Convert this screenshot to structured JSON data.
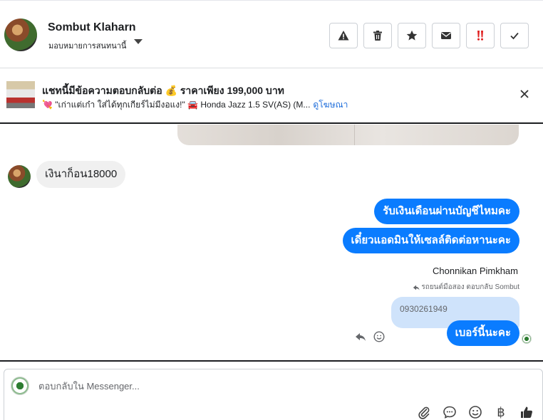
{
  "header": {
    "user_name": "Sombut Klaharn",
    "assign_label": "มอบหมายการสนทนานี้",
    "actions": [
      "warning-icon",
      "trash-icon",
      "star-icon",
      "envelope-icon",
      "important-icon",
      "check-icon"
    ]
  },
  "ad": {
    "title": "แชทนี้มีข้อความตอบกลับต่อ 💰 ราคาเพียง 199,000 บาท",
    "subtitle": "💘 \"เก่าแต่เก๋า ใส่ได้ทุกเกียร์ไม่มีงอแง!\" 🚘 Honda Jazz 1.5 SV(AS) (M...",
    "link": "ดูโฆษณา"
  },
  "messages": {
    "incoming": "เงินาก็อน18000",
    "outgoing_1": "รับเงินเดือนผ่านบัญชีไหมคะ",
    "outgoing_2": "เดี๋ยวแอดมินให้เซลล์ติดต่อหานะคะ",
    "sender": "Chonnikan Pimkham",
    "reply_note": "รถยนต์มือสอง ตอบกลับ Sombut",
    "quoted": "0930261949",
    "outgoing_3": "เบอร์นี้นะคะ"
  },
  "composer": {
    "placeholder": "ตอบกลับใน Messenger..."
  },
  "colors": {
    "accent": "#0a7cff",
    "link": "#216fdb",
    "important": "#e02020"
  }
}
